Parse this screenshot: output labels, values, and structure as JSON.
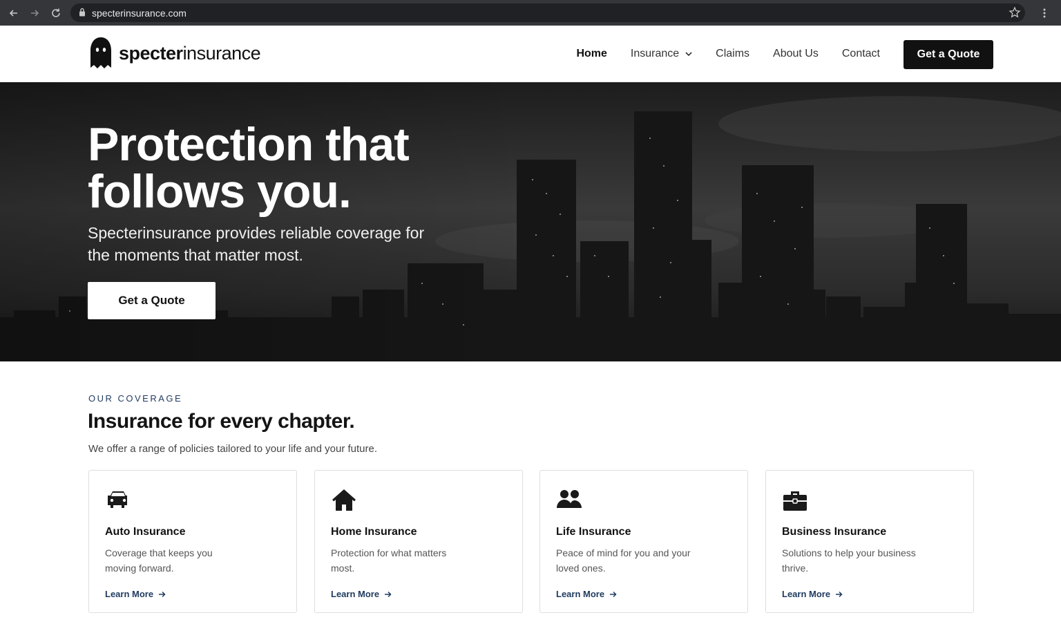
{
  "browser": {
    "url": "specterinsurance.com",
    "icons": [
      "back-icon",
      "forward-icon",
      "reload-icon",
      "lock-icon",
      "star-icon",
      "menu-dots-icon"
    ]
  },
  "header": {
    "logo_bold": "specter",
    "logo_light": "insurance",
    "nav": [
      {
        "label": "Home",
        "active": true
      },
      {
        "label": "Insurance",
        "dropdown": true
      },
      {
        "label": "Claims"
      },
      {
        "label": "About Us"
      },
      {
        "label": "Contact"
      }
    ],
    "cta": "Get a Quote"
  },
  "hero": {
    "title_line1": "Protection that",
    "title_line2": "follows you.",
    "subtitle": "Specterinsurance provides reliable coverage for the moments that matter most.",
    "cta": "Get a Quote"
  },
  "coverage": {
    "eyebrow": "OUR COVERAGE",
    "title": "Insurance for every chapter.",
    "subtitle": "We offer a range of policies tailored to your life and your future.",
    "cards": [
      {
        "icon": "car-icon",
        "title": "Auto Insurance",
        "desc": "Coverage that keeps you moving forward.",
        "link": "Learn More"
      },
      {
        "icon": "house-icon",
        "title": "Home Insurance",
        "desc": "Protection for what matters most.",
        "link": "Learn More"
      },
      {
        "icon": "people-icon",
        "title": "Life Insurance",
        "desc": "Peace of mind for you and your loved ones.",
        "link": "Learn More"
      },
      {
        "icon": "briefcase-icon",
        "title": "Business Insurance",
        "desc": "Solutions to help your business thrive.",
        "link": "Learn More"
      }
    ]
  },
  "colors": {
    "accent": "#1f3a5f",
    "dark": "#111111",
    "chrome": "#35363a"
  }
}
